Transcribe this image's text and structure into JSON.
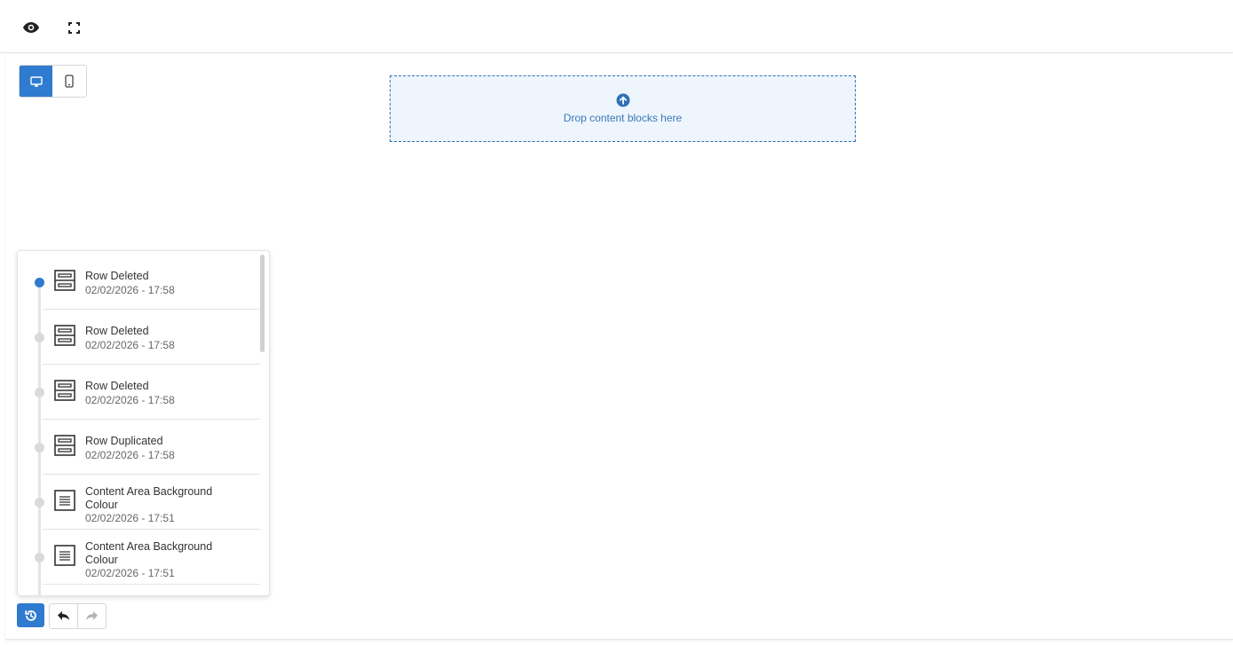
{
  "toolbar": {
    "preview_icon": "eye-icon",
    "fullscreen_icon": "fullscreen-icon"
  },
  "device_toggle": {
    "selected": "desktop",
    "options": [
      "desktop",
      "mobile"
    ]
  },
  "dropzone": {
    "text": "Drop content blocks here",
    "icon": "upload-arrow-icon"
  },
  "history": {
    "items": [
      {
        "title": "Row Deleted",
        "time": "02/02/2026 - 17:58",
        "icon": "row-icon",
        "active": true
      },
      {
        "title": "Row Deleted",
        "time": "02/02/2026 - 17:58",
        "icon": "row-icon",
        "active": false
      },
      {
        "title": "Row Deleted",
        "time": "02/02/2026 - 17:58",
        "icon": "row-icon",
        "active": false
      },
      {
        "title": "Row Duplicated",
        "time": "02/02/2026 - 17:58",
        "icon": "row-icon",
        "active": false
      },
      {
        "title": "Content Area Background Colour",
        "time": "02/02/2026 - 17:51",
        "icon": "content-area-icon",
        "active": false
      },
      {
        "title": "Content Area Background Colour",
        "time": "02/02/2026 - 17:51",
        "icon": "content-area-icon",
        "active": false
      }
    ]
  },
  "colors": {
    "accent": "#2e7bcf",
    "dropzone_bg": "#eef5fd",
    "dropzone_border": "#2e6fb5"
  }
}
